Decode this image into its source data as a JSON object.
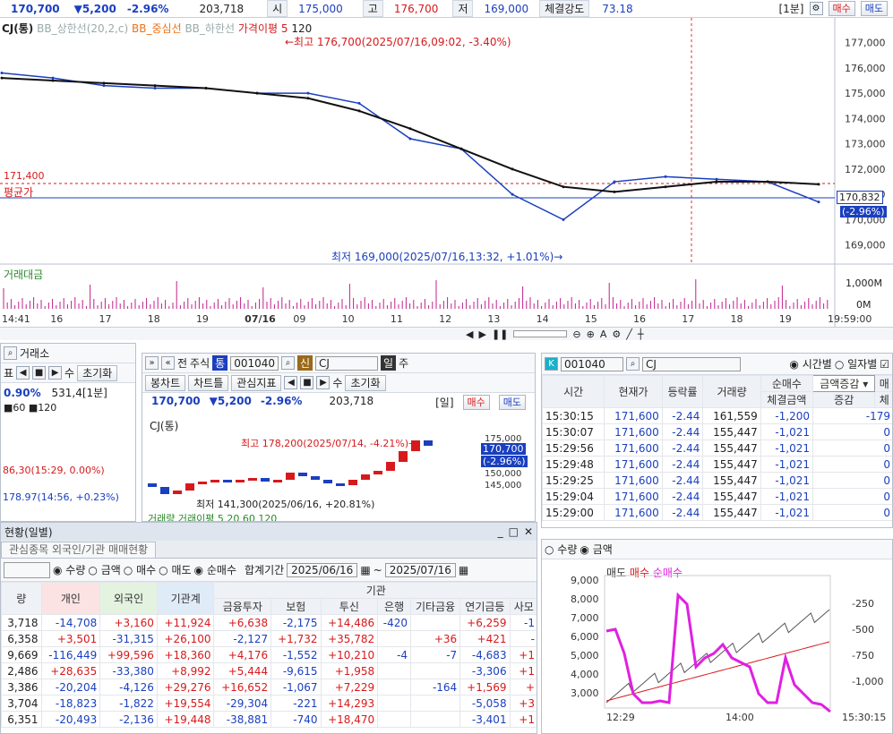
{
  "topbar": {
    "price": "170,700",
    "change": "▼5,200",
    "pct": "-2.96%",
    "volume": "203,718",
    "open_label": "시",
    "open": "175,000",
    "high_label": "고",
    "high": "176,700",
    "low_label": "저",
    "low": "169,000",
    "strength_label": "체결강도",
    "strength": "73.18",
    "interval": "[1분]",
    "buy": "매수",
    "sell": "매도"
  },
  "main_chart": {
    "legend": {
      "name": "CJ(통)",
      "bb_upper": "BB_상한선(20,2,c)",
      "bb_mid": "BB_중심선",
      "bb_lower": "BB_하한선",
      "ma_label": "가격이평 5",
      "ma_val": "120"
    },
    "high_note": "←최고 176,700(2025/07/16,09:02, -3.40%)",
    "low_note": "최저 169,000(2025/07/16,13:32, +1.01%)→",
    "avg_price": "171,400",
    "avg_label": "평균가",
    "cur_price": "170,832",
    "cur_pct": "(-2.96%)",
    "volume_label": "거래대금",
    "vol_axis": [
      "1,000M",
      "0M"
    ],
    "y_ticks": [
      "177,000",
      "176,000",
      "175,000",
      "174,000",
      "173,000",
      "172,000",
      "171,000",
      "170,000",
      "169,000"
    ],
    "x_ticks": [
      "14:41",
      "16",
      "17",
      "18",
      "19",
      "07/16",
      "09",
      "10",
      "11",
      "12",
      "13",
      "14",
      "15",
      "16",
      "17",
      "18",
      "19",
      "19:59:00"
    ]
  },
  "chart_data": {
    "type": "line",
    "title": "CJ(통)",
    "x": [
      "14:41",
      "16",
      "17",
      "18",
      "19",
      "07/16",
      "09",
      "10",
      "11",
      "12",
      "13",
      "14",
      "15",
      "16",
      "17",
      "18",
      "19"
    ],
    "series": [
      {
        "name": "가격",
        "values": [
          175800,
          175600,
          175300,
          175200,
          175200,
          175000,
          175000,
          174600,
          173200,
          172800,
          171000,
          170000,
          171500,
          171700,
          171600,
          171500,
          170700
        ]
      },
      {
        "name": "120",
        "values": [
          175600,
          175500,
          175400,
          175300,
          175200,
          175000,
          174800,
          174300,
          173600,
          172800,
          172000,
          171300,
          171100,
          171300,
          171500,
          171500,
          171400
        ]
      }
    ],
    "ylim": [
      168600,
      177800
    ],
    "volume": {
      "name": "거래대금",
      "ylim": [
        0,
        1000
      ]
    }
  },
  "left_panel": {
    "title": "거래소",
    "tb": [
      "표",
      "수",
      "초기화"
    ],
    "pct": "0.90%",
    "val": "531,4[1분]",
    "ma": [
      "60",
      "120"
    ],
    "note1": "86,30(15:29, 0.00%)",
    "note2": "178.97(14:56, +0.23%)"
  },
  "mid_panel": {
    "toolbar1": [
      "전",
      "주식",
      "통"
    ],
    "code": "001040",
    "name": "CJ",
    "tag": "신",
    "day": "일",
    "week": "주",
    "tb2": [
      "봉차트",
      "차트틀",
      "관심지표",
      "수",
      "초기화"
    ],
    "price": "170,700",
    "change": "▼5,200",
    "pct": "-2.96%",
    "volume": "203,718",
    "interval": "[일]",
    "buy": "매수",
    "sell": "매도",
    "legend": "CJ(통)",
    "high_note": "최고 178,200(2025/07/14, -4.21%)→",
    "low_note": "최저 141,300(2025/06/16, +20.81%)",
    "cur_price": "170,700",
    "cur_pct": "(-2.96%)",
    "y_ticks": [
      "175,000",
      "160,000",
      "155,000",
      "150,000",
      "145,000"
    ],
    "bottom_legend": "거래량  거래이평 5  20  60  120"
  },
  "right_panel": {
    "code": "001040",
    "name": "CJ",
    "radio1": "시간별",
    "radio2": "일자별",
    "headers": [
      "시간",
      "현재가",
      "등락률",
      "거래량",
      "순매수",
      "체결금액",
      "증감"
    ],
    "combo": "금액증감",
    "extra": [
      "매",
      "체"
    ],
    "rows": [
      [
        "15:30:15",
        "171,600",
        "-2.44",
        "161,559",
        "-1,200",
        "-179"
      ],
      [
        "15:30:07",
        "171,600",
        "-2.44",
        "155,447",
        "-1,021",
        "0"
      ],
      [
        "15:29:56",
        "171,600",
        "-2.44",
        "155,447",
        "-1,021",
        "0"
      ],
      [
        "15:29:48",
        "171,600",
        "-2.44",
        "155,447",
        "-1,021",
        "0"
      ],
      [
        "15:29:25",
        "171,600",
        "-2.44",
        "155,447",
        "-1,021",
        "0"
      ],
      [
        "15:29:04",
        "171,600",
        "-2.44",
        "155,447",
        "-1,021",
        "0"
      ],
      [
        "15:29:00",
        "171,600",
        "-2.44",
        "155,447",
        "-1,021",
        "0"
      ]
    ]
  },
  "flow_chart": {
    "radio1": "수량",
    "radio2": "금액",
    "legend": [
      "매도",
      "매수",
      "순매수"
    ],
    "y_left": [
      "9,000",
      "8,000",
      "7,000",
      "6,000",
      "5,000",
      "4,000",
      "3,000"
    ],
    "y_right": [
      "-250",
      "-500",
      "-750",
      "-1,000"
    ],
    "x": [
      "12:29",
      "14:00",
      "15:30:15"
    ]
  },
  "bottom_panel": {
    "title": "현황(일별)",
    "tab": "관심종목 외국인/기관 매매현황",
    "radios": [
      "수량",
      "금액",
      "매수",
      "매도",
      "순매수"
    ],
    "period_label": "합계기간",
    "date_from": "2025/06/16",
    "date_to": "2025/07/16",
    "group_header": "기관",
    "headers": [
      "량",
      "개인",
      "외국인",
      "기관계",
      "금융투자",
      "보험",
      "투신",
      "은행",
      "기타금융",
      "연기금등",
      "사모"
    ],
    "rows": [
      [
        "3,718",
        "-14,708",
        "+3,160",
        "+11,924",
        "+6,638",
        "-2,175",
        "+14,486",
        "-420",
        "",
        "+6,259",
        "-1"
      ],
      [
        "6,358",
        "+3,501",
        "-31,315",
        "+26,100",
        "-2,127",
        "+1,732",
        "+35,782",
        "",
        "+36",
        "+421",
        "-"
      ],
      [
        "9,669",
        "-116,449",
        "+99,596",
        "+18,360",
        "+4,176",
        "-1,552",
        "+10,210",
        "-4",
        "-7",
        "-4,683",
        "+1"
      ],
      [
        "2,486",
        "+28,635",
        "-33,380",
        "+8,992",
        "+5,444",
        "-9,615",
        "+1,958",
        "",
        "",
        "-3,306",
        "+1"
      ],
      [
        "3,386",
        "-20,204",
        "-4,126",
        "+29,276",
        "+16,652",
        "-1,067",
        "+7,229",
        "",
        "-164",
        "+1,569",
        "+"
      ],
      [
        "3,704",
        "-18,823",
        "-1,822",
        "+19,554",
        "-29,304",
        "-221",
        "+14,293",
        "",
        "",
        "-5,058",
        "+3"
      ],
      [
        "6,351",
        "-20,493",
        "-2,136",
        "+19,448",
        "-38,881",
        "-740",
        "+18,470",
        "",
        "",
        "-3,401",
        "+1"
      ]
    ]
  }
}
